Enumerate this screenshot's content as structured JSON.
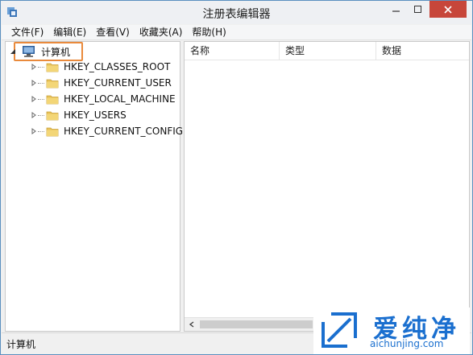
{
  "window": {
    "title": "注册表编辑器"
  },
  "menu": [
    "文件(F)",
    "编辑(E)",
    "查看(V)",
    "收藏夹(A)",
    "帮助(H)"
  ],
  "tree": {
    "root_label": "计算机",
    "children": [
      "HKEY_CLASSES_ROOT",
      "HKEY_CURRENT_USER",
      "HKEY_LOCAL_MACHINE",
      "HKEY_USERS",
      "HKEY_CURRENT_CONFIG"
    ]
  },
  "list": {
    "columns": [
      "名称",
      "类型",
      "数据"
    ]
  },
  "status": {
    "text": "计算机"
  },
  "watermark": {
    "brand": "爱纯净",
    "url": "aichunjing.com"
  },
  "colors": {
    "highlight": "#e98a3c",
    "close_button": "#c7463a",
    "watermark": "#1a6fcf"
  }
}
